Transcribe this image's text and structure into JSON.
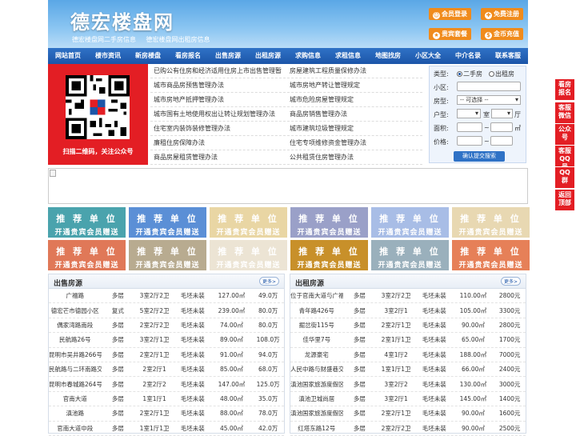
{
  "header": {
    "logo": "德宏楼盘网",
    "sub_links": [
      "德宏楼盘网二手房信息",
      "德宏楼盘网出租房信息"
    ],
    "buttons": [
      {
        "label": "会员登录",
        "icon": "user-icon"
      },
      {
        "label": "免费注册",
        "icon": "register-icon"
      },
      {
        "label": "贵宾套餐",
        "icon": "vip-icon"
      },
      {
        "label": "金币充值",
        "icon": "coin-icon"
      }
    ]
  },
  "nav": [
    "网站首页",
    "楼市资讯",
    "新房楼盘",
    "看房报名",
    "出售房源",
    "出租房源",
    "求购信息",
    "求租信息",
    "地图找房",
    "小区大全",
    "中介名录",
    "联系客服"
  ],
  "qr": {
    "caption": "扫描二维码，关注公众号"
  },
  "links": [
    [
      "已购公有住房和经济适用住房上市出售管理暂",
      "房屋建筑工程质量保修办法"
    ],
    [
      "城市商品房预售管理办法",
      "城市房地产转让管理规定"
    ],
    [
      "城市房地产抵押管理办法",
      "城市危险房屋管理规定"
    ],
    [
      "城市国有土地使用权出让转让规划管理办法",
      "商品房销售管理办法"
    ],
    [
      "住宅室内装饰装修管理办法",
      "城市建筑垃圾管理规定"
    ],
    [
      "廉租住房保障办法",
      "住宅专项维修资金管理办法"
    ],
    [
      "商品房屋租赁管理办法",
      "公共租赁住房管理办法"
    ]
  ],
  "search": {
    "type_label": "类型:",
    "type_options": [
      "二手房",
      "出租房"
    ],
    "community_label": "小区:",
    "layout_label": "房型:",
    "layout_placeholder": "-- 可选择 --",
    "unit_label": "户型:",
    "room_unit": "室",
    "hall_unit": "厅",
    "area_label": "面积:",
    "area_unit": "㎡",
    "price_label": "价格:",
    "range_sep": "~",
    "submit": "确认提交搜索"
  },
  "ads": {
    "line1": "推 荐 单 位",
    "line2": "开通贵宾会员赠送",
    "colors": [
      "#4aa3ad",
      "#5b8fd6",
      "#e9d6a4",
      "#9aa0c8",
      "#a8bde6",
      "#e8d8b2",
      "#e07858",
      "#b8ab90",
      "#ece4d4",
      "#c8902a",
      "#9ab0bc",
      "#e68058"
    ]
  },
  "sale": {
    "title": "出售房源",
    "more": "更多>",
    "rows": [
      [
        "广福路",
        "多层",
        "3室2厅2卫",
        "毛坯未装",
        "127.00㎡",
        "49.0万"
      ],
      [
        "德宏芒市德园小区",
        "复式",
        "5室2厅2卫",
        "毛坯未装",
        "239.00㎡",
        "80.0万"
      ],
      [
        "偶家湾路南段",
        "多层",
        "2室2厅2卫",
        "毛坯未装",
        "74.00㎡",
        "80.0万"
      ],
      [
        "民航路26号",
        "多层",
        "3室2厅1卫",
        "毛坯未装",
        "89.00㎡",
        "108.0万"
      ],
      [
        "昆明市吴井路266号",
        "多层",
        "2室2厅1卫",
        "毛坯未装",
        "91.00㎡",
        "94.0万"
      ],
      [
        "民航路与二环南路交叉",
        "多层",
        "2室2厅1",
        "毛坯未装",
        "85.00㎡",
        "68.0万"
      ],
      [
        "昆明市春城路264号",
        "多层",
        "2室2厅2",
        "毛坯未装",
        "147.00㎡",
        "125.0万"
      ],
      [
        "官南大道",
        "多层",
        "1室1厅1",
        "毛坯未装",
        "48.00㎡",
        "35.0万"
      ],
      [
        "滇池路",
        "多层",
        "2室2厅1卫",
        "毛坯未装",
        "88.00㎡",
        "78.0万"
      ],
      [
        "官南大道中段",
        "多层",
        "1室1厅1卫",
        "毛坯未装",
        "45.00㎡",
        "42.0万"
      ]
    ]
  },
  "rent": {
    "title": "出租房源",
    "more": "更多>",
    "rows": [
      [
        "位于官南大道与广福路",
        "多层",
        "3室2厅2卫",
        "毛坯未装",
        "110.00㎡",
        "2800元"
      ],
      [
        "青年路426号",
        "多层",
        "3室2厅1",
        "毛坯未装",
        "105.00㎡",
        "3300元"
      ],
      [
        "掘岔街115号",
        "多层",
        "2室2厅1卫",
        "毛坯未装",
        "90.00㎡",
        "2800元"
      ],
      [
        "佳华里7号",
        "多层",
        "2室1厅1卫",
        "毛坯未装",
        "65.00㎡",
        "1700元"
      ],
      [
        "龙源豪宅",
        "多层",
        "4室1厅2",
        "毛坯未装",
        "188.00㎡",
        "7000元"
      ],
      [
        "人民中路与财盛巷交叉",
        "多层",
        "1室1厅1卫",
        "毛坯未装",
        "66.00㎡",
        "2400元"
      ],
      [
        "滇池国家旅游度假区往",
        "多层",
        "3室2厅2",
        "毛坯未装",
        "130.00㎡",
        "3000元"
      ],
      [
        "滇池卫城尚居",
        "多层",
        "3室2厅1",
        "毛坯未装",
        "145.00㎡",
        "1400元"
      ],
      [
        "滇池国家旅游度假区往",
        "多层",
        "2室2厅1卫",
        "毛坯未装",
        "90.00㎡",
        "1600元"
      ],
      [
        "红塔东路12号",
        "多层",
        "2室2厅2卫",
        "毛坯未装",
        "90.00㎡",
        "2500元"
      ]
    ]
  },
  "float": [
    {
      "label": "看房报名"
    },
    {
      "label": "客服微信"
    },
    {
      "label": "公众号"
    },
    {
      "label": "客服QQ号"
    },
    {
      "label": "QQ群"
    },
    {
      "label": "返回顶部"
    }
  ]
}
